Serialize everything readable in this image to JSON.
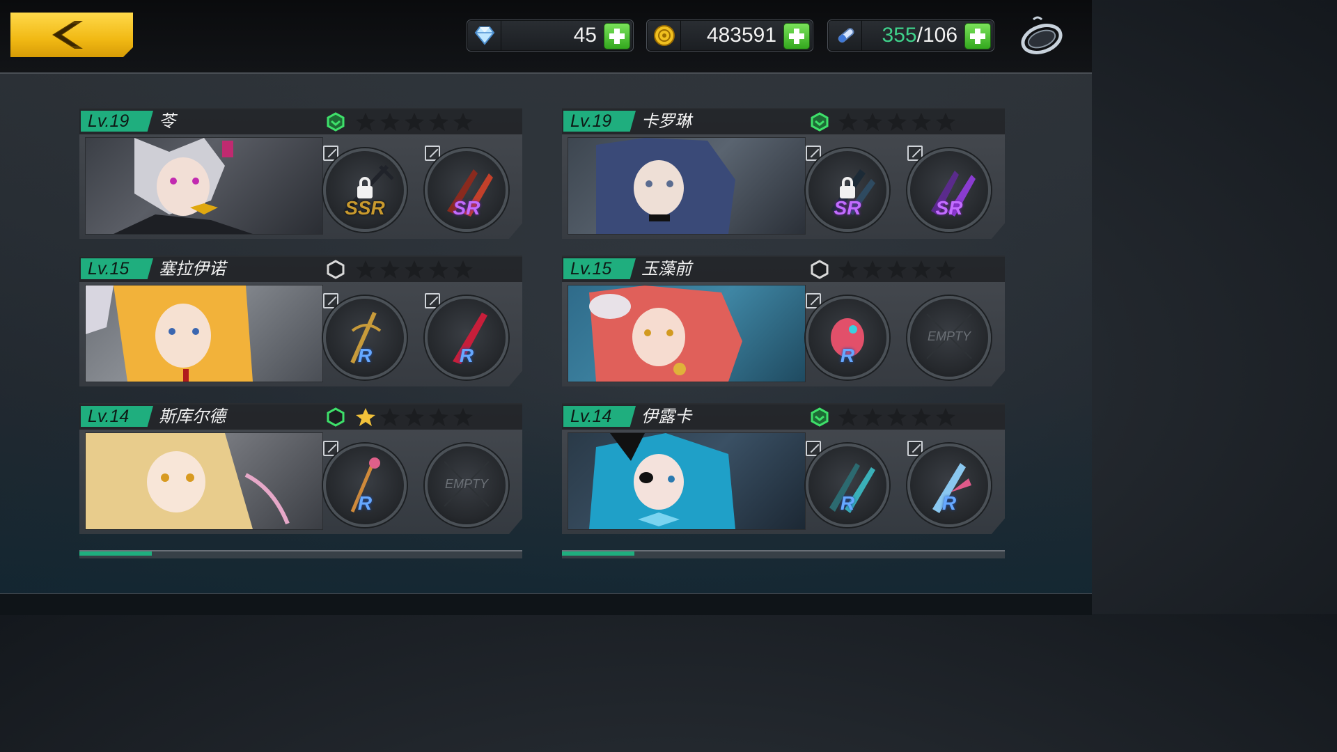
{
  "header": {
    "back_label": "",
    "resources": [
      {
        "icon": "diamond-icon",
        "value": "45"
      },
      {
        "icon": "gold-coin-icon",
        "value": "483591"
      },
      {
        "icon": "stamina-vial-icon",
        "value_current": "355",
        "value_sep_max": "/106"
      }
    ],
    "menu_icon": "ring-menu-icon"
  },
  "colors": {
    "level_badge": "#1fae7e",
    "plus": "#3fbe2a",
    "back": "#f5c21f",
    "ssr": "#c99a2e",
    "sr": "#c26cff",
    "r": "#66a8ff"
  },
  "characters": [
    {
      "level": "Lv.19",
      "name": "苓",
      "gem": "green",
      "stars": 0,
      "slots": [
        {
          "rank": "SSR",
          "locked": true
        },
        {
          "rank": "SR",
          "locked": false
        }
      ]
    },
    {
      "level": "Lv.19",
      "name": "卡罗琳",
      "gem": "green",
      "stars": 0,
      "slots": [
        {
          "rank": "SR",
          "locked": true
        },
        {
          "rank": "SR",
          "locked": false
        }
      ]
    },
    {
      "level": "Lv.15",
      "name": "塞拉伊诺",
      "gem": "empty",
      "stars": 0,
      "slots": [
        {
          "rank": "R"
        },
        {
          "rank": "R"
        }
      ]
    },
    {
      "level": "Lv.15",
      "name": "玉藻前",
      "gem": "empty",
      "stars": 0,
      "slots": [
        {
          "rank": "R"
        },
        {
          "empty": "EMPTY"
        }
      ]
    },
    {
      "level": "Lv.14",
      "name": "斯库尔德",
      "gem": "green-outline",
      "stars": 1,
      "slots": [
        {
          "rank": "R"
        },
        {
          "empty": "EMPTY"
        }
      ]
    },
    {
      "level": "Lv.14",
      "name": "伊露卡",
      "gem": "green",
      "stars": 0,
      "slots": [
        {
          "rank": "R"
        },
        {
          "rank": "R"
        }
      ]
    }
  ]
}
